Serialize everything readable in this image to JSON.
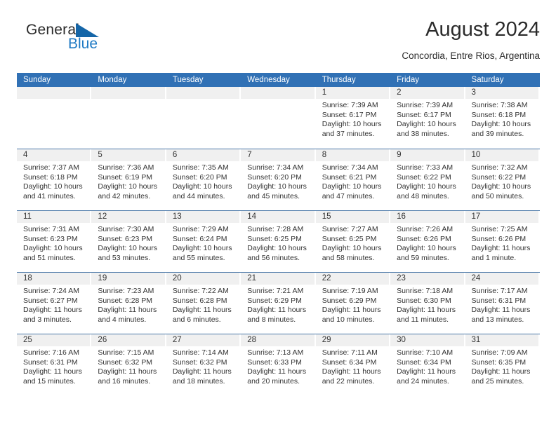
{
  "brand": {
    "name_top": "General",
    "name_bottom": "Blue",
    "triangle_icon": "blue-triangle-icon",
    "color_top": "#2b2b2b",
    "color_bottom": "#1f7ac4"
  },
  "header": {
    "title": "August 2024",
    "location": "Concordia, Entre Rios, Argentina"
  },
  "theme": {
    "header_blue": "#3171b5",
    "row_divider": "#4b78a8",
    "daynum_band": "#f0f0f0",
    "text": "#333333"
  },
  "weekdays": [
    "Sunday",
    "Monday",
    "Tuesday",
    "Wednesday",
    "Thursday",
    "Friday",
    "Saturday"
  ],
  "weeks": [
    [
      {
        "day": "",
        "sunrise": "",
        "sunset": "",
        "daylight_1": "",
        "daylight_2": ""
      },
      {
        "day": "",
        "sunrise": "",
        "sunset": "",
        "daylight_1": "",
        "daylight_2": ""
      },
      {
        "day": "",
        "sunrise": "",
        "sunset": "",
        "daylight_1": "",
        "daylight_2": ""
      },
      {
        "day": "",
        "sunrise": "",
        "sunset": "",
        "daylight_1": "",
        "daylight_2": ""
      },
      {
        "day": "1",
        "sunrise": "Sunrise: 7:39 AM",
        "sunset": "Sunset: 6:17 PM",
        "daylight_1": "Daylight: 10 hours",
        "daylight_2": "and 37 minutes."
      },
      {
        "day": "2",
        "sunrise": "Sunrise: 7:39 AM",
        "sunset": "Sunset: 6:17 PM",
        "daylight_1": "Daylight: 10 hours",
        "daylight_2": "and 38 minutes."
      },
      {
        "day": "3",
        "sunrise": "Sunrise: 7:38 AM",
        "sunset": "Sunset: 6:18 PM",
        "daylight_1": "Daylight: 10 hours",
        "daylight_2": "and 39 minutes."
      }
    ],
    [
      {
        "day": "4",
        "sunrise": "Sunrise: 7:37 AM",
        "sunset": "Sunset: 6:18 PM",
        "daylight_1": "Daylight: 10 hours",
        "daylight_2": "and 41 minutes."
      },
      {
        "day": "5",
        "sunrise": "Sunrise: 7:36 AM",
        "sunset": "Sunset: 6:19 PM",
        "daylight_1": "Daylight: 10 hours",
        "daylight_2": "and 42 minutes."
      },
      {
        "day": "6",
        "sunrise": "Sunrise: 7:35 AM",
        "sunset": "Sunset: 6:20 PM",
        "daylight_1": "Daylight: 10 hours",
        "daylight_2": "and 44 minutes."
      },
      {
        "day": "7",
        "sunrise": "Sunrise: 7:34 AM",
        "sunset": "Sunset: 6:20 PM",
        "daylight_1": "Daylight: 10 hours",
        "daylight_2": "and 45 minutes."
      },
      {
        "day": "8",
        "sunrise": "Sunrise: 7:34 AM",
        "sunset": "Sunset: 6:21 PM",
        "daylight_1": "Daylight: 10 hours",
        "daylight_2": "and 47 minutes."
      },
      {
        "day": "9",
        "sunrise": "Sunrise: 7:33 AM",
        "sunset": "Sunset: 6:22 PM",
        "daylight_1": "Daylight: 10 hours",
        "daylight_2": "and 48 minutes."
      },
      {
        "day": "10",
        "sunrise": "Sunrise: 7:32 AM",
        "sunset": "Sunset: 6:22 PM",
        "daylight_1": "Daylight: 10 hours",
        "daylight_2": "and 50 minutes."
      }
    ],
    [
      {
        "day": "11",
        "sunrise": "Sunrise: 7:31 AM",
        "sunset": "Sunset: 6:23 PM",
        "daylight_1": "Daylight: 10 hours",
        "daylight_2": "and 51 minutes."
      },
      {
        "day": "12",
        "sunrise": "Sunrise: 7:30 AM",
        "sunset": "Sunset: 6:23 PM",
        "daylight_1": "Daylight: 10 hours",
        "daylight_2": "and 53 minutes."
      },
      {
        "day": "13",
        "sunrise": "Sunrise: 7:29 AM",
        "sunset": "Sunset: 6:24 PM",
        "daylight_1": "Daylight: 10 hours",
        "daylight_2": "and 55 minutes."
      },
      {
        "day": "14",
        "sunrise": "Sunrise: 7:28 AM",
        "sunset": "Sunset: 6:25 PM",
        "daylight_1": "Daylight: 10 hours",
        "daylight_2": "and 56 minutes."
      },
      {
        "day": "15",
        "sunrise": "Sunrise: 7:27 AM",
        "sunset": "Sunset: 6:25 PM",
        "daylight_1": "Daylight: 10 hours",
        "daylight_2": "and 58 minutes."
      },
      {
        "day": "16",
        "sunrise": "Sunrise: 7:26 AM",
        "sunset": "Sunset: 6:26 PM",
        "daylight_1": "Daylight: 10 hours",
        "daylight_2": "and 59 minutes."
      },
      {
        "day": "17",
        "sunrise": "Sunrise: 7:25 AM",
        "sunset": "Sunset: 6:26 PM",
        "daylight_1": "Daylight: 11 hours",
        "daylight_2": "and 1 minute."
      }
    ],
    [
      {
        "day": "18",
        "sunrise": "Sunrise: 7:24 AM",
        "sunset": "Sunset: 6:27 PM",
        "daylight_1": "Daylight: 11 hours",
        "daylight_2": "and 3 minutes."
      },
      {
        "day": "19",
        "sunrise": "Sunrise: 7:23 AM",
        "sunset": "Sunset: 6:28 PM",
        "daylight_1": "Daylight: 11 hours",
        "daylight_2": "and 4 minutes."
      },
      {
        "day": "20",
        "sunrise": "Sunrise: 7:22 AM",
        "sunset": "Sunset: 6:28 PM",
        "daylight_1": "Daylight: 11 hours",
        "daylight_2": "and 6 minutes."
      },
      {
        "day": "21",
        "sunrise": "Sunrise: 7:21 AM",
        "sunset": "Sunset: 6:29 PM",
        "daylight_1": "Daylight: 11 hours",
        "daylight_2": "and 8 minutes."
      },
      {
        "day": "22",
        "sunrise": "Sunrise: 7:19 AM",
        "sunset": "Sunset: 6:29 PM",
        "daylight_1": "Daylight: 11 hours",
        "daylight_2": "and 10 minutes."
      },
      {
        "day": "23",
        "sunrise": "Sunrise: 7:18 AM",
        "sunset": "Sunset: 6:30 PM",
        "daylight_1": "Daylight: 11 hours",
        "daylight_2": "and 11 minutes."
      },
      {
        "day": "24",
        "sunrise": "Sunrise: 7:17 AM",
        "sunset": "Sunset: 6:31 PM",
        "daylight_1": "Daylight: 11 hours",
        "daylight_2": "and 13 minutes."
      }
    ],
    [
      {
        "day": "25",
        "sunrise": "Sunrise: 7:16 AM",
        "sunset": "Sunset: 6:31 PM",
        "daylight_1": "Daylight: 11 hours",
        "daylight_2": "and 15 minutes."
      },
      {
        "day": "26",
        "sunrise": "Sunrise: 7:15 AM",
        "sunset": "Sunset: 6:32 PM",
        "daylight_1": "Daylight: 11 hours",
        "daylight_2": "and 16 minutes."
      },
      {
        "day": "27",
        "sunrise": "Sunrise: 7:14 AM",
        "sunset": "Sunset: 6:32 PM",
        "daylight_1": "Daylight: 11 hours",
        "daylight_2": "and 18 minutes."
      },
      {
        "day": "28",
        "sunrise": "Sunrise: 7:13 AM",
        "sunset": "Sunset: 6:33 PM",
        "daylight_1": "Daylight: 11 hours",
        "daylight_2": "and 20 minutes."
      },
      {
        "day": "29",
        "sunrise": "Sunrise: 7:11 AM",
        "sunset": "Sunset: 6:34 PM",
        "daylight_1": "Daylight: 11 hours",
        "daylight_2": "and 22 minutes."
      },
      {
        "day": "30",
        "sunrise": "Sunrise: 7:10 AM",
        "sunset": "Sunset: 6:34 PM",
        "daylight_1": "Daylight: 11 hours",
        "daylight_2": "and 24 minutes."
      },
      {
        "day": "31",
        "sunrise": "Sunrise: 7:09 AM",
        "sunset": "Sunset: 6:35 PM",
        "daylight_1": "Daylight: 11 hours",
        "daylight_2": "and 25 minutes."
      }
    ]
  ]
}
